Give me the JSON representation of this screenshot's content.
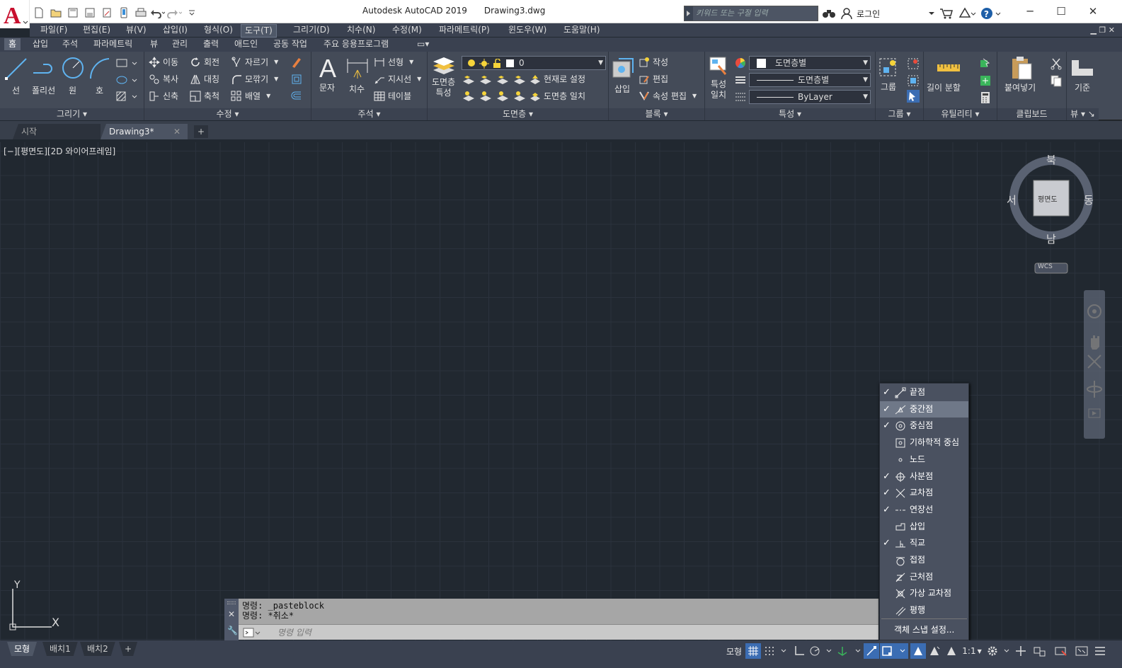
{
  "title": {
    "app": "Autodesk AutoCAD 2019",
    "file": "Drawing3.dwg"
  },
  "search": {
    "placeholder": "키워드 또는 구절 입력"
  },
  "login": "로그인",
  "menu": [
    "파일(F)",
    "편집(E)",
    "뷰(V)",
    "삽입(I)",
    "형식(O)",
    "도구(T)",
    "그리기(D)",
    "치수(N)",
    "수정(M)",
    "파라메트릭(P)",
    "윈도우(W)",
    "도움말(H)"
  ],
  "ribbon_tabs": [
    "홈",
    "삽입",
    "주석",
    "파라메트릭",
    "뷰",
    "관리",
    "출력",
    "애드인",
    "공동 작업",
    "주요 응용프로그램"
  ],
  "draw": {
    "line": "선",
    "polyline": "폴리선",
    "circle": "원",
    "arc": "호",
    "title": "그리기"
  },
  "modify": {
    "move": "이동",
    "rotate": "회전",
    "trim": "자르기",
    "copy": "복사",
    "mirror": "대칭",
    "fillet": "모깎기",
    "stretch": "신축",
    "scale": "축척",
    "array": "배열",
    "title": "수정"
  },
  "annotation": {
    "text": "문자",
    "dim": "치수",
    "linear": "선형",
    "leader": "지시선",
    "table": "테이블",
    "title": "주석"
  },
  "layers": {
    "props1": "도면층",
    "props2": "특성",
    "current": "0",
    "setcur": "현재로 설정",
    "match": "도면층 일치",
    "title": "도면층"
  },
  "block": {
    "insert": "삽입",
    "create": "작성",
    "edit": "편집",
    "attedit": "속성 편집",
    "title": "블록"
  },
  "properties": {
    "match1": "특성",
    "match2": "일치",
    "color": "도면층별",
    "linetype": "도면층별",
    "lineweight": "ByLayer",
    "title": "특성"
  },
  "groups": {
    "group": "그룹",
    "title": "그룹"
  },
  "utilities": {
    "measure": "길이 분할",
    "title": "유틸리티"
  },
  "clipboard": {
    "paste": "붙여넣기",
    "title": "클립보드"
  },
  "view": {
    "base": "기준",
    "title": "뷰"
  },
  "doc_tabs": [
    "시작",
    "Drawing3*"
  ],
  "viewport_label": "[−][평면도][2D 와이어프레임]",
  "viewcube": {
    "n": "북",
    "s": "남",
    "e": "동",
    "w": "서",
    "face": "평면도",
    "wcs": "WCS"
  },
  "ucs": {
    "x": "X",
    "y": "Y"
  },
  "command": {
    "line1": "명령: _pasteblock",
    "line2": "명령: *취소*",
    "placeholder": "명령 입력"
  },
  "snap_menu": [
    {
      "label": "끝점",
      "checked": true,
      "icon": "endpoint-icon"
    },
    {
      "label": "중간점",
      "checked": true,
      "icon": "midpoint-icon",
      "highlight": true
    },
    {
      "label": "중심점",
      "checked": true,
      "icon": "center-icon"
    },
    {
      "label": "기하학적 중심",
      "checked": false,
      "icon": "geocenter-icon"
    },
    {
      "label": "노드",
      "checked": false,
      "icon": "node-icon"
    },
    {
      "label": "사분점",
      "checked": true,
      "icon": "quadrant-icon"
    },
    {
      "label": "교차점",
      "checked": true,
      "icon": "intersection-icon"
    },
    {
      "label": "연장선",
      "checked": true,
      "icon": "extension-icon"
    },
    {
      "label": "삽입",
      "checked": false,
      "icon": "insertion-icon"
    },
    {
      "label": "직교",
      "checked": true,
      "icon": "perpendicular-icon"
    },
    {
      "label": "접점",
      "checked": false,
      "icon": "tangent-icon"
    },
    {
      "label": "근처점",
      "checked": false,
      "icon": "nearest-icon"
    },
    {
      "label": "가상 교차점",
      "checked": false,
      "icon": "apparent-intersection-icon"
    },
    {
      "label": "평행",
      "checked": false,
      "icon": "parallel-icon"
    }
  ],
  "snap_settings": "객체 스냅 설정...",
  "layout_tabs": [
    "모형",
    "배치1",
    "배치2"
  ],
  "status": {
    "model": "모형",
    "scale": "1:1"
  }
}
